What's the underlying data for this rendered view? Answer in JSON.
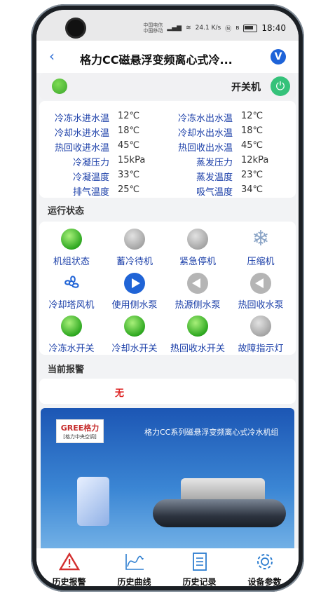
{
  "status_bar": {
    "carrier1": "中国电信",
    "carrier2": "中国移动",
    "speed": "24.1 K/s",
    "time": "18:40"
  },
  "header": {
    "back_icon": "chevron-left",
    "title": "格力CC磁悬浮变频离心式冷...",
    "badge": "V"
  },
  "power": {
    "label": "开关机",
    "led_color": "#4caf32",
    "button_color": "#35c27a"
  },
  "params": {
    "left": [
      {
        "label": "冷冻水进水温",
        "value": "12℃"
      },
      {
        "label": "冷却水进水温",
        "value": "18℃"
      },
      {
        "label": "热回收进水温",
        "value": "45℃"
      },
      {
        "label": "冷凝压力",
        "value": "15kPa"
      },
      {
        "label": "冷凝温度",
        "value": "33℃"
      },
      {
        "label": "排气温度",
        "value": "25℃"
      }
    ],
    "right": [
      {
        "label": "冷冻水出水温",
        "value": "12℃"
      },
      {
        "label": "冷却水出水温",
        "value": "18℃"
      },
      {
        "label": "热回收出水温",
        "value": "45℃"
      },
      {
        "label": "蒸发压力",
        "value": "12kPa"
      },
      {
        "label": "蒸发温度",
        "value": "23℃"
      },
      {
        "label": "吸气温度",
        "value": "34℃"
      }
    ]
  },
  "running_status": {
    "title": "运行状态",
    "items": [
      {
        "label": "机组状态",
        "icon": "green-led"
      },
      {
        "label": "蓄冷待机",
        "icon": "gray-led"
      },
      {
        "label": "紧急停机",
        "icon": "gray-led"
      },
      {
        "label": "压缩机",
        "icon": "snowflake-icon"
      },
      {
        "label": "冷却塔风机",
        "icon": "fan-icon"
      },
      {
        "label": "使用侧水泵",
        "icon": "pump-blue-icon"
      },
      {
        "label": "热源侧水泵",
        "icon": "pump-gray-icon"
      },
      {
        "label": "热回收水泵",
        "icon": "pump-gray-icon"
      },
      {
        "label": "冷冻水开关",
        "icon": "green-led"
      },
      {
        "label": "冷却水开关",
        "icon": "green-led"
      },
      {
        "label": "热回收水开关",
        "icon": "green-led"
      },
      {
        "label": "故障指示灯",
        "icon": "gray-led"
      }
    ]
  },
  "alarm": {
    "title": "当前报警",
    "value": "无"
  },
  "banner": {
    "logo_top": "GREE格力",
    "logo_bottom": "[格力中央空调]",
    "title": "格力CC系列磁悬浮变频离心式冷水机组"
  },
  "bottom_nav": [
    {
      "label": "历史报警",
      "icon": "warning-icon"
    },
    {
      "label": "历史曲线",
      "icon": "chart-curve-icon"
    },
    {
      "label": "历史记录",
      "icon": "document-icon"
    },
    {
      "label": "设备参数",
      "icon": "gear-icon"
    }
  ]
}
